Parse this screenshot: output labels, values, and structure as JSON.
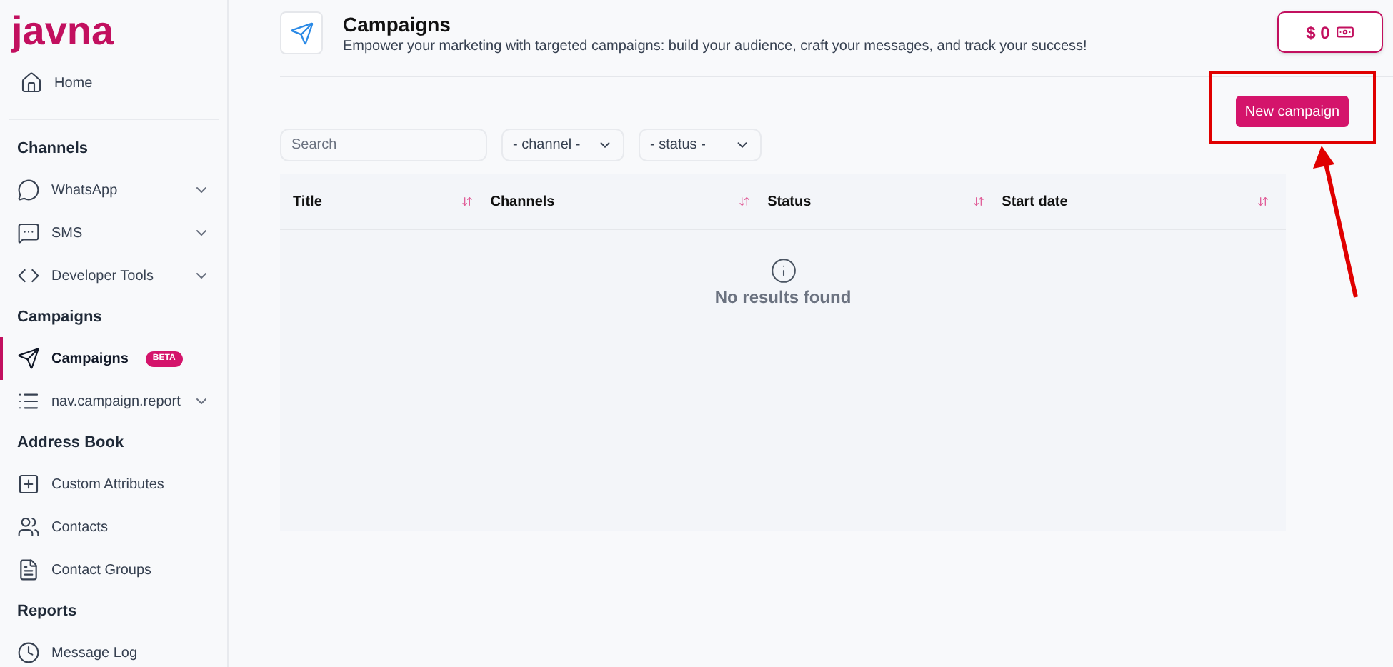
{
  "sidebar": {
    "logo": "javna",
    "sections": [
      {
        "items": [
          {
            "label": "Home",
            "kind": "home",
            "selected": false,
            "expandable": false
          }
        ]
      },
      {
        "heading": "Channels",
        "items": [
          {
            "label": "WhatsApp",
            "kind": "whatsapp",
            "selected": false,
            "expandable": true
          },
          {
            "label": "SMS",
            "kind": "chat",
            "selected": false,
            "expandable": true
          },
          {
            "label": "Developer Tools",
            "kind": "code",
            "selected": false,
            "expandable": true
          }
        ]
      },
      {
        "heading": "Campaigns",
        "items": [
          {
            "label": "Campaigns",
            "kind": "send",
            "selected": true,
            "expandable": false,
            "badge": "BETA"
          },
          {
            "label": "nav.campaign.report",
            "kind": "list",
            "selected": false,
            "expandable": true
          }
        ]
      },
      {
        "heading": "Address Book",
        "items": [
          {
            "label": "Custom Attributes",
            "kind": "attr",
            "selected": false,
            "expandable": false
          },
          {
            "label": "Contacts",
            "kind": "contacts",
            "selected": false,
            "expandable": false
          },
          {
            "label": "Contact Groups",
            "kind": "groups",
            "selected": false,
            "expandable": false
          }
        ]
      },
      {
        "heading": "Reports",
        "items": [
          {
            "label": "Message Log",
            "kind": "clock",
            "selected": false,
            "expandable": false
          }
        ]
      }
    ]
  },
  "header": {
    "title": "Campaigns",
    "subtitle": "Empower your marketing with targeted campaigns: build your audience, craft your messages, and track your success!",
    "balance": "$ 0"
  },
  "toolbar": {
    "search": {
      "placeholder": "Search"
    },
    "filters": [
      "- channel -",
      "- status -"
    ],
    "new_button": "New campaign"
  },
  "table": {
    "columns": [
      "Title",
      "Channels",
      "Status",
      "Start date"
    ],
    "empty_message": "No results found"
  }
}
